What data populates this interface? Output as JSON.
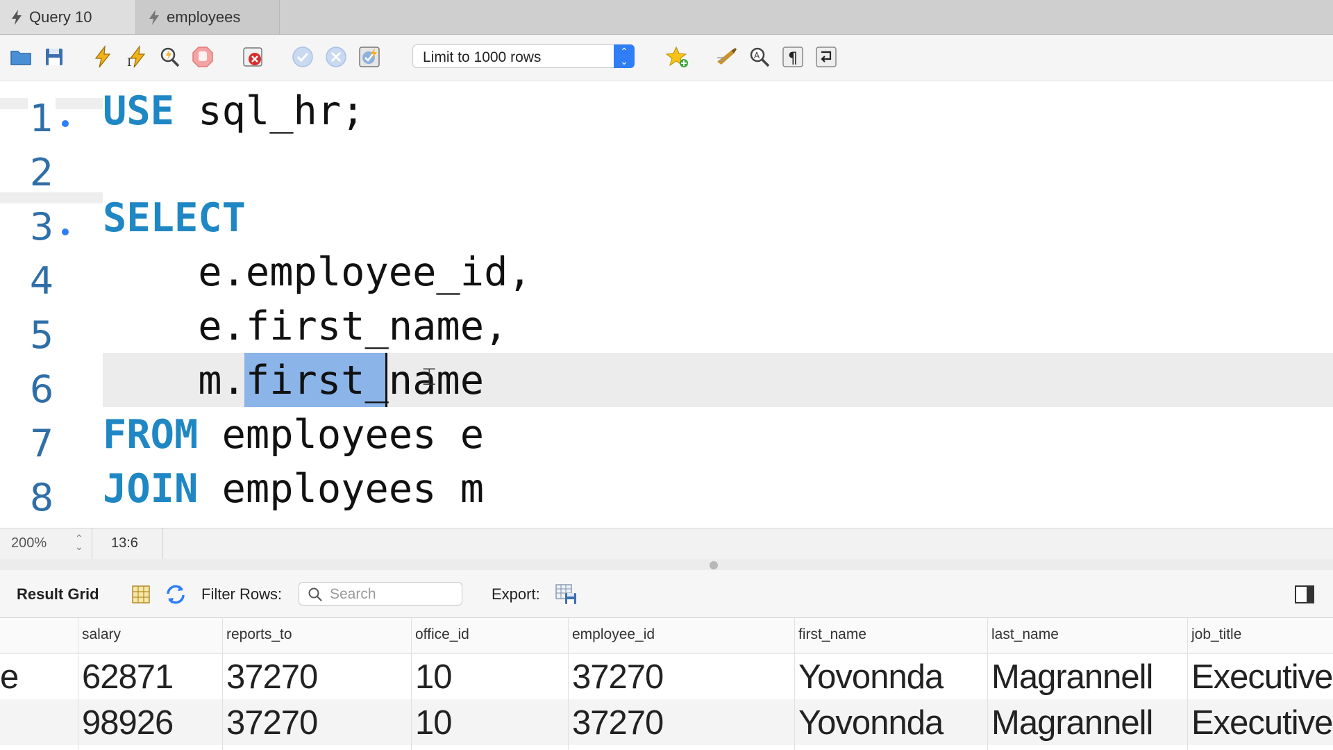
{
  "tabs": [
    {
      "label": "Query 10",
      "active": true
    },
    {
      "label": "employees",
      "active": false
    }
  ],
  "toolbar": {
    "limit_select": "Limit to 1000 rows",
    "icons": [
      "open-folder-icon",
      "save-icon",
      "execute-icon",
      "execute-current-icon",
      "explain-icon",
      "stop-icon",
      "error-toggle-icon",
      "commit-icon",
      "rollback-icon",
      "autocommit-icon",
      "bookmark-star-icon",
      "beautify-icon",
      "find-icon",
      "invisibles-icon",
      "wrap-icon"
    ]
  },
  "editor": {
    "lines": [
      {
        "no": "1",
        "fold": true,
        "tokens": [
          {
            "t": "USE",
            "kw": true
          },
          {
            "t": " sql_hr;",
            "kw": false
          }
        ]
      },
      {
        "no": "2",
        "fold": false,
        "tokens": []
      },
      {
        "no": "3",
        "fold": true,
        "tokens": [
          {
            "t": "SELECT",
            "kw": true
          }
        ]
      },
      {
        "no": "4",
        "fold": false,
        "tokens": [
          {
            "t": "    e.employee_id,",
            "kw": false
          }
        ]
      },
      {
        "no": "5",
        "fold": false,
        "tokens": [
          {
            "t": "    e.first_name,",
            "kw": false
          }
        ]
      },
      {
        "no": "6",
        "fold": false,
        "tokens": [
          {
            "t": "    m.first_name",
            "kw": false
          }
        ]
      },
      {
        "no": "7",
        "fold": false,
        "tokens": [
          {
            "t": "FROM",
            "kw": true
          },
          {
            "t": " employees e",
            "kw": false
          }
        ]
      },
      {
        "no": "8",
        "fold": false,
        "tokens": [
          {
            "t": "JOIN",
            "kw": true
          },
          {
            "t": " employees m",
            "kw": false
          }
        ]
      }
    ],
    "selected_text": "first_"
  },
  "status": {
    "zoom": "200%",
    "cursor_position": "13:6"
  },
  "result_toolbar": {
    "title": "Result Grid",
    "filter_label": "Filter Rows:",
    "search_placeholder": "Search",
    "export_label": "Export:"
  },
  "grid": {
    "columns": [
      "salary",
      "reports_to",
      "office_id",
      "employee_id",
      "first_name",
      "last_name",
      "job_title"
    ],
    "rows": [
      [
        "e",
        "62871",
        "37270",
        "10",
        "37270",
        "Yovonnda",
        "Magrannell",
        "Executive"
      ],
      [
        "",
        "98926",
        "37270",
        "10",
        "37270",
        "Yovonnda",
        "Magrannell",
        "Executive"
      ]
    ]
  }
}
